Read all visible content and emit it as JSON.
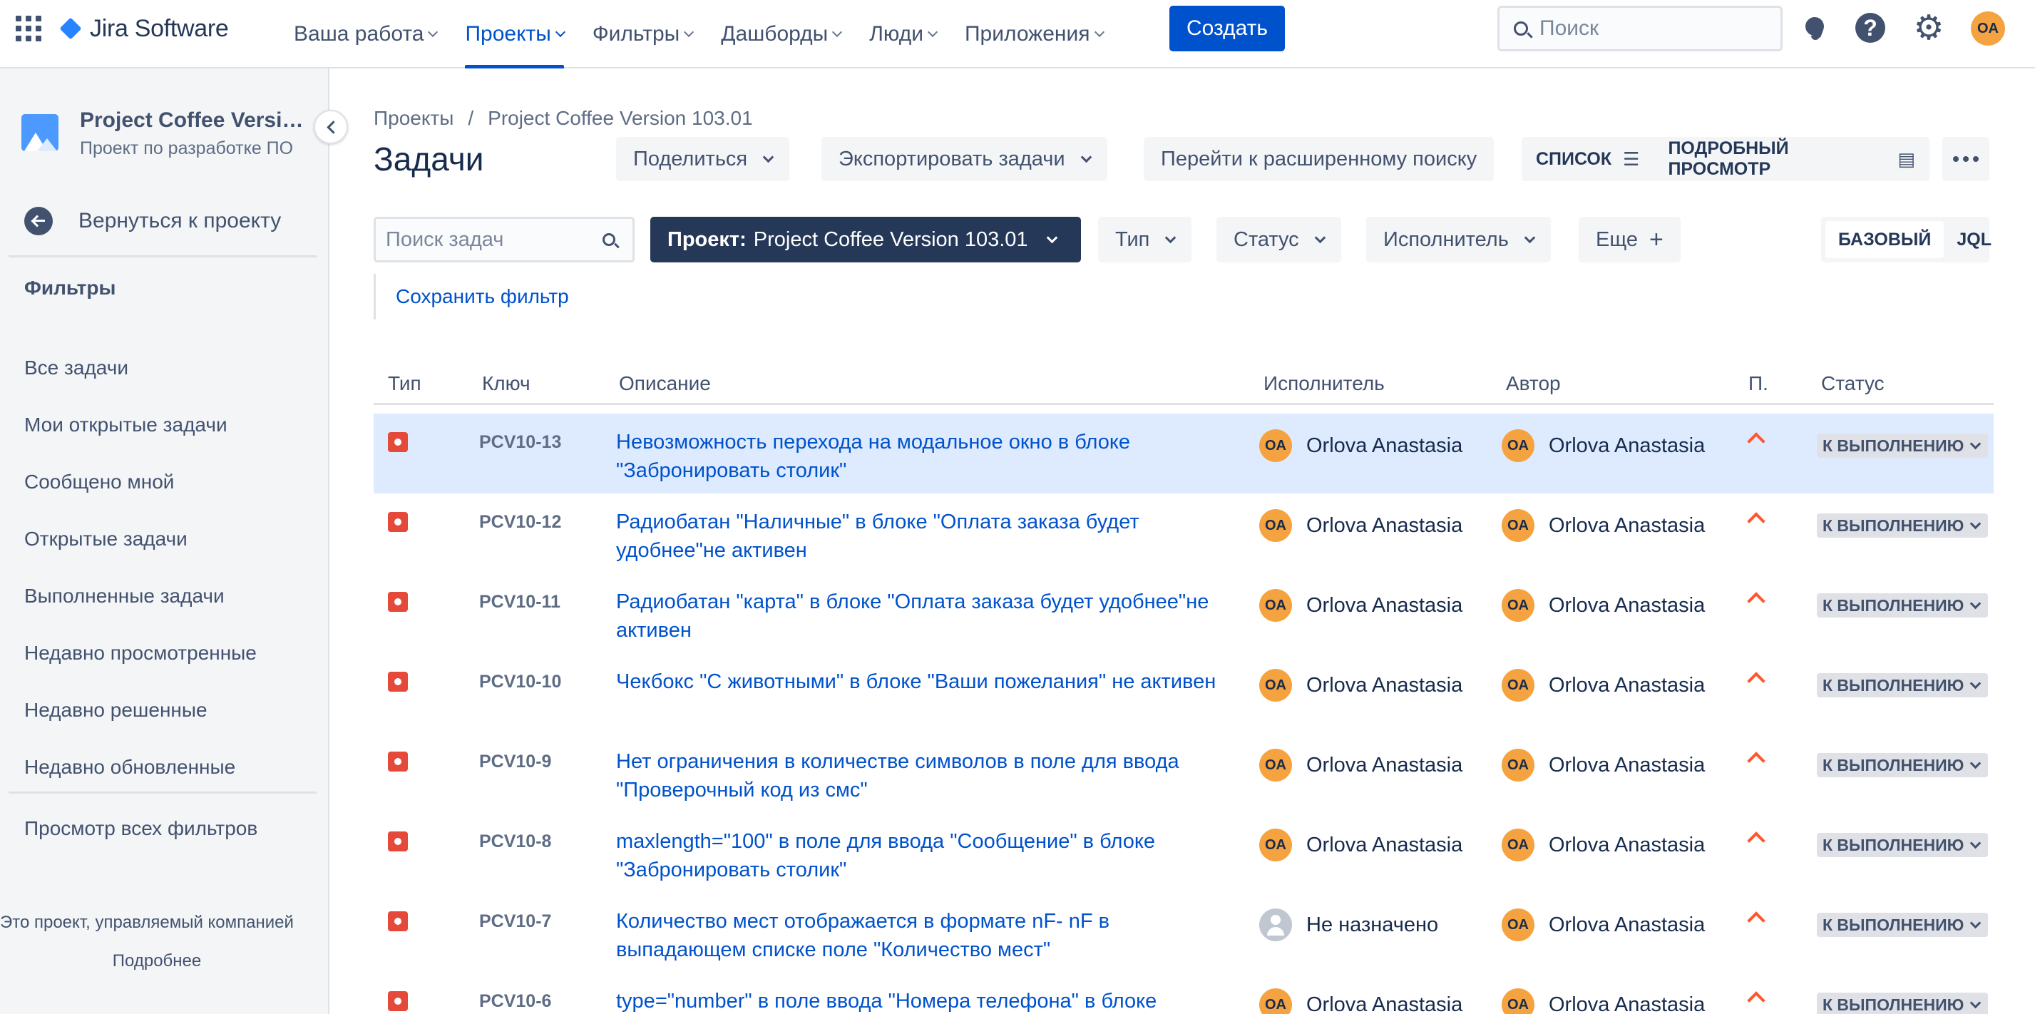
{
  "app": {
    "name": "Jira Software"
  },
  "nav": {
    "items": [
      {
        "label": "Ваша работа",
        "active": false
      },
      {
        "label": "Проекты",
        "active": true
      },
      {
        "label": "Фильтры",
        "active": false
      },
      {
        "label": "Дашборды",
        "active": false
      },
      {
        "label": "Люди",
        "active": false
      },
      {
        "label": "Приложения",
        "active": false
      }
    ],
    "create_label": "Создать",
    "search_placeholder": "Поиск",
    "user_initials": "OA"
  },
  "sidebar": {
    "project_name": "Project Coffee Versio...",
    "project_type": "Проект по разработке ПО",
    "back_label": "Вернуться к проекту",
    "filters_heading": "Фильтры",
    "items": [
      {
        "label": "Все задачи"
      },
      {
        "label": "Мои открытые задачи"
      },
      {
        "label": "Сообщено мной"
      },
      {
        "label": "Открытые задачи"
      },
      {
        "label": "Выполненные задачи"
      },
      {
        "label": "Недавно просмотренные"
      },
      {
        "label": "Недавно решенные"
      },
      {
        "label": "Недавно обновленные"
      }
    ],
    "all_filters_label": "Просмотр всех фильтров",
    "footer_text": "Это проект, управляемый компанией",
    "footer_link": "Подробнее"
  },
  "page": {
    "breadcrumb": [
      "Проекты",
      "Project Coffee Version 103.01"
    ],
    "breadcrumb_sep": "/",
    "title": "Задачи",
    "actions": {
      "share": "Поделиться",
      "export": "Экспортировать задачи",
      "advanced": "Перейти к расширенному поиску",
      "list_view": "СПИСОК",
      "detail_view": "ПОДРОБНЫЙ ПРОСМОТР"
    },
    "filters": {
      "search_placeholder": "Поиск задач",
      "project_prefix": "Проект:",
      "project_value": "Project Coffee Version 103.01",
      "type": "Тип",
      "status": "Статус",
      "assignee": "Исполнитель",
      "more": "Еще",
      "mode_basic": "БАЗОВЫЙ",
      "mode_jql": "JQL",
      "save_filter": "Сохранить фильтр"
    }
  },
  "table": {
    "columns": {
      "type": "Тип",
      "key": "Ключ",
      "summary": "Описание",
      "assignee": "Исполнитель",
      "reporter": "Автор",
      "priority": "П.",
      "status": "Статус"
    },
    "rows": [
      {
        "key": "PCV10-13",
        "summary": "Невозможность перехода на модальное окно в блоке \"Забронировать столик\"",
        "assignee": "Orlova Anastasia",
        "assignee_initials": "OA",
        "reporter": "Orlova Anastasia",
        "reporter_initials": "OA",
        "status": "К ВЫПОЛНЕНИЮ"
      },
      {
        "key": "PCV10-12",
        "summary": "Радиобатан \"Наличные\" в блоке \"Оплата заказа будет удобнее\"не активен",
        "assignee": "Orlova Anastasia",
        "assignee_initials": "OA",
        "reporter": "Orlova Anastasia",
        "reporter_initials": "OA",
        "status": "К ВЫПОЛНЕНИЮ"
      },
      {
        "key": "PCV10-11",
        "summary": "Радиобатан \"карта\" в блоке \"Оплата заказа будет удобнее\"не активен",
        "assignee": "Orlova Anastasia",
        "assignee_initials": "OA",
        "reporter": "Orlova Anastasia",
        "reporter_initials": "OA",
        "status": "К ВЫПОЛНЕНИЮ"
      },
      {
        "key": "PCV10-10",
        "summary": "Чекбокс \"С животными\" в блоке \"Ваши пожелания\" не активен",
        "assignee": "Orlova Anastasia",
        "assignee_initials": "OA",
        "reporter": "Orlova Anastasia",
        "reporter_initials": "OA",
        "status": "К ВЫПОЛНЕНИЮ"
      },
      {
        "key": "PCV10-9",
        "summary": "Нет ограничения в количестве символов в поле для ввода \"Проверочный код из смс\"",
        "assignee": "Orlova Anastasia",
        "assignee_initials": "OA",
        "reporter": "Orlova Anastasia",
        "reporter_initials": "OA",
        "status": "К ВЫПОЛНЕНИЮ"
      },
      {
        "key": "PCV10-8",
        "summary": "maxlength=\"100\" в поле для ввода \"Сообщение\" в блоке \"Забронировать столик\"",
        "assignee": "Orlova Anastasia",
        "assignee_initials": "OA",
        "reporter": "Orlova Anastasia",
        "reporter_initials": "OA",
        "status": "К ВЫПОЛНЕНИЮ"
      },
      {
        "key": "PCV10-7",
        "summary": "Количество мест отображается в формате nF- nF в выпадающем списке поле \"Количество мест\"",
        "assignee": "Не назначено",
        "assignee_initials": "",
        "reporter": "Orlova Anastasia",
        "reporter_initials": "OA",
        "status": "К ВЫПОЛНЕНИЮ"
      },
      {
        "key": "PCV10-6",
        "summary": "type=\"number\" в поле ввода \"Номера телефона\" в блоке",
        "assignee": "Orlova Anastasia",
        "assignee_initials": "OA",
        "reporter": "Orlova Anastasia",
        "reporter_initials": "OA",
        "status": "К ВЫПОЛНЕНИЮ"
      }
    ]
  }
}
